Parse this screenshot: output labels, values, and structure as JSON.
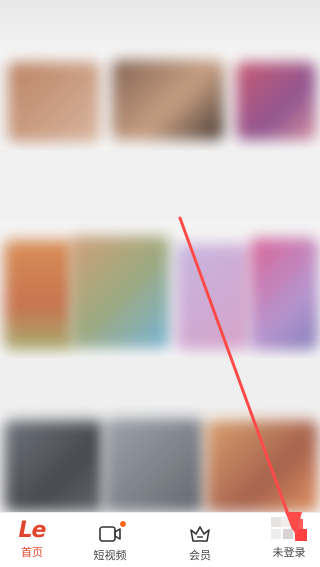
{
  "bottom_nav": {
    "items": [
      {
        "id": "home",
        "label": "首页",
        "icon": "le-logo",
        "active": true,
        "logo_text": "Le"
      },
      {
        "id": "short-video",
        "label": "短视频",
        "icon": "video-camera-icon",
        "badge_dot": true
      },
      {
        "id": "vip",
        "label": "会员",
        "icon": "crown-icon"
      },
      {
        "id": "account",
        "label": "未登录",
        "icon": "avatar-icon"
      }
    ]
  },
  "colors": {
    "accent": "#e2452f",
    "arrow": "#ff4a4a",
    "badge": "#ff6a1a"
  },
  "annotation": {
    "type": "arrow",
    "points_to": "account"
  }
}
